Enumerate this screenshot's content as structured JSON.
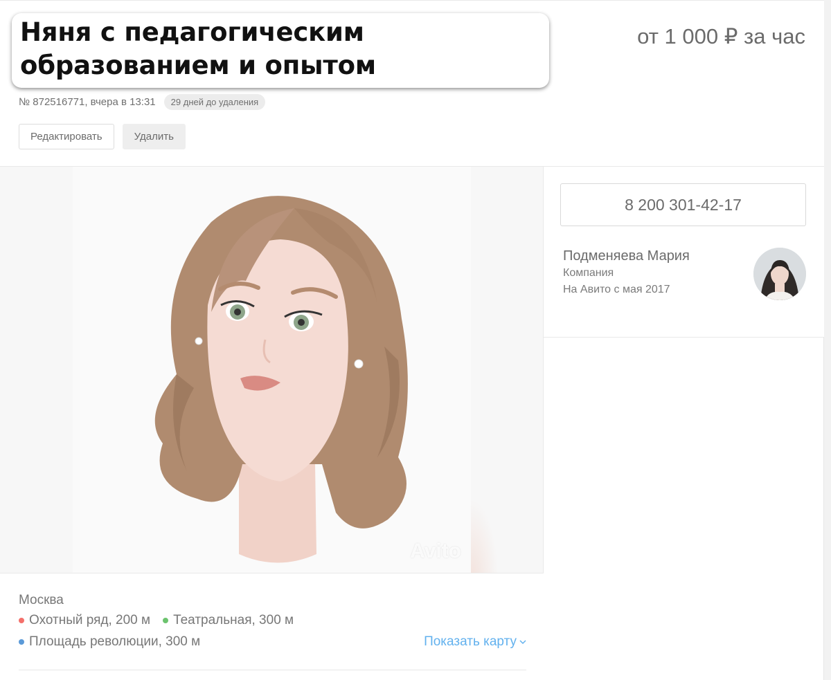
{
  "listing": {
    "title": "Няня с педагогическим образованием и опытом",
    "price": "от 1 000 ₽ за час",
    "number_date": "№ 872516771, вчера в 13:31",
    "deletion_badge": "29 дней до удаления"
  },
  "actions": {
    "edit_label": "Редактировать",
    "delete_label": "Удалить"
  },
  "gallery": {
    "watermark": "Avito"
  },
  "location": {
    "city": "Москва",
    "metro": [
      {
        "name": "Охотный ряд, 200 м",
        "color": "#f4706b"
      },
      {
        "name": "Театральная, 300 м",
        "color": "#6cc36e"
      },
      {
        "name": "Площадь революции, 300 м",
        "color": "#5b9ad8"
      }
    ],
    "show_map_label": "Показать карту"
  },
  "seller": {
    "phone": "8 200 301-42-17",
    "name": "Подменяева Мария",
    "type": "Компания",
    "since": "На Авито с мая 2017"
  },
  "icons": {
    "map_chevron": "chevron-down-icon",
    "metro_dot": "metro-dot-icon"
  }
}
